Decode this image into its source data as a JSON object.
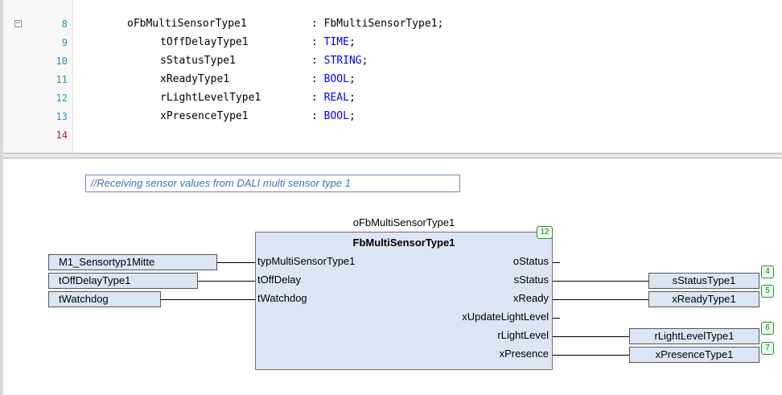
{
  "declaration": {
    "fold_symbol": "−",
    "lines": [
      {
        "num": "8",
        "name": "oFbMultiSensorType1",
        "sep": ": ",
        "type": "FbMultiSensorType1",
        "type_is_keyword": false,
        "end": ";"
      },
      {
        "num": "9",
        "name": "tOffDelayType1",
        "sep": ": ",
        "type": "TIME",
        "type_is_keyword": true,
        "end": ";"
      },
      {
        "num": "10",
        "name": "sStatusType1",
        "sep": ": ",
        "type": "STRING",
        "type_is_keyword": true,
        "end": ";"
      },
      {
        "num": "11",
        "name": "xReadyType1",
        "sep": ": ",
        "type": "BOOL",
        "type_is_keyword": true,
        "end": ";"
      },
      {
        "num": "12",
        "name": "rLightLevelType1",
        "sep": ": ",
        "type": "REAL",
        "type_is_keyword": true,
        "end": ";"
      },
      {
        "num": "13",
        "name": "xPresenceType1",
        "sep": ": ",
        "type": "BOOL",
        "type_is_keyword": true,
        "end": ";"
      },
      {
        "num": "14",
        "name": "",
        "sep": "",
        "type": "",
        "type_is_keyword": false,
        "end": ""
      }
    ]
  },
  "fbd": {
    "comment": "//Receiving sensor values from DALI multi sensor type 1",
    "block": {
      "instance": "oFbMultiSensorType1",
      "type": "FbMultiSensorType1",
      "exec_order": "12",
      "inputs": [
        "typMultiSensorType1",
        "tOffDelay",
        "tWatchdog"
      ],
      "outputs": [
        "oStatus",
        "sStatus",
        "xReady",
        "xUpdateLightLevel",
        "rLightLevel",
        "xPresence"
      ]
    },
    "input_vars": [
      "M1_Sensortyp1Mitte",
      "tOffDelayType1",
      "tWatchdog"
    ],
    "output_vars": [
      {
        "label": "sStatusType1",
        "order": "4"
      },
      {
        "label": "xReadyType1",
        "order": "5"
      },
      {
        "label": "rLightLevelType1",
        "order": "6"
      },
      {
        "label": "xPresenceType1",
        "order": "7"
      }
    ],
    "colors": {
      "block_fill": "#dbe6f4",
      "comment_text": "#3f6fb5",
      "keyword": "#0000ff",
      "line_number": "#2b91af",
      "order_badge": "#2e8b2e"
    }
  }
}
